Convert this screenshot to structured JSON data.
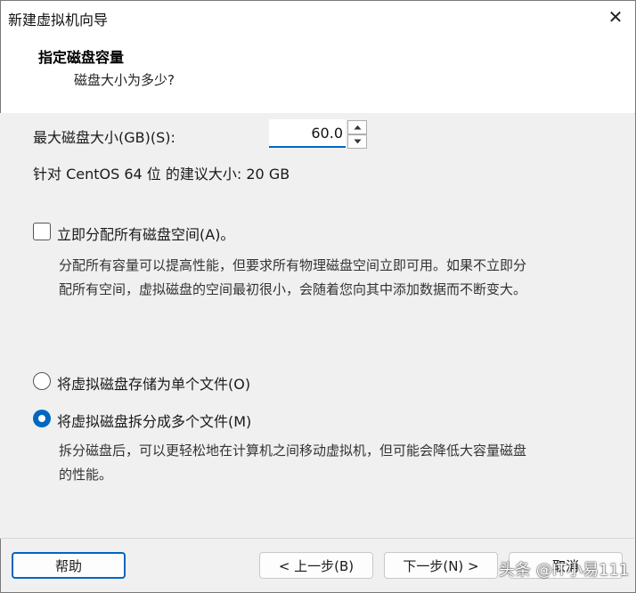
{
  "window": {
    "title": "新建虚拟机向导",
    "close_glyph": "✕"
  },
  "header": {
    "title": "指定磁盘容量",
    "subtitle": "磁盘大小为多少?"
  },
  "disk_size": {
    "label": "最大磁盘大小(GB)(S):",
    "value": "60.0",
    "recommend_prefix": "针对 CentOS 64 位 的建议大小",
    "recommend_value": ": 20 GB"
  },
  "allocate": {
    "label": "立即分配所有磁盘空间(A)。",
    "checked": false,
    "desc_line1": "分配所有容量可以提高性能，但要求所有物理磁盘空间立即可用。如果不立即分",
    "desc_line2": "配所有空间，虚拟磁盘的空间最初很小，会随着您向其中添加数据而不断变大。"
  },
  "options": {
    "single": {
      "label": "将虚拟磁盘存储为单个文件(O)",
      "selected": false
    },
    "multi": {
      "label": "将虚拟磁盘拆分成多个文件(M)",
      "selected": true,
      "desc_line1": "拆分磁盘后，可以更轻松地在计算机之间移动虚拟机，但可能会降低大容量磁盘",
      "desc_line2": "的性能。"
    }
  },
  "footer": {
    "help": "帮助",
    "back": "< 上一步(B)",
    "next": "下一步(N) >",
    "cancel": "取消"
  },
  "watermark": "头条 @IT小易111",
  "colors": {
    "accent": "#0067c0",
    "background": "#f0f0f0"
  }
}
